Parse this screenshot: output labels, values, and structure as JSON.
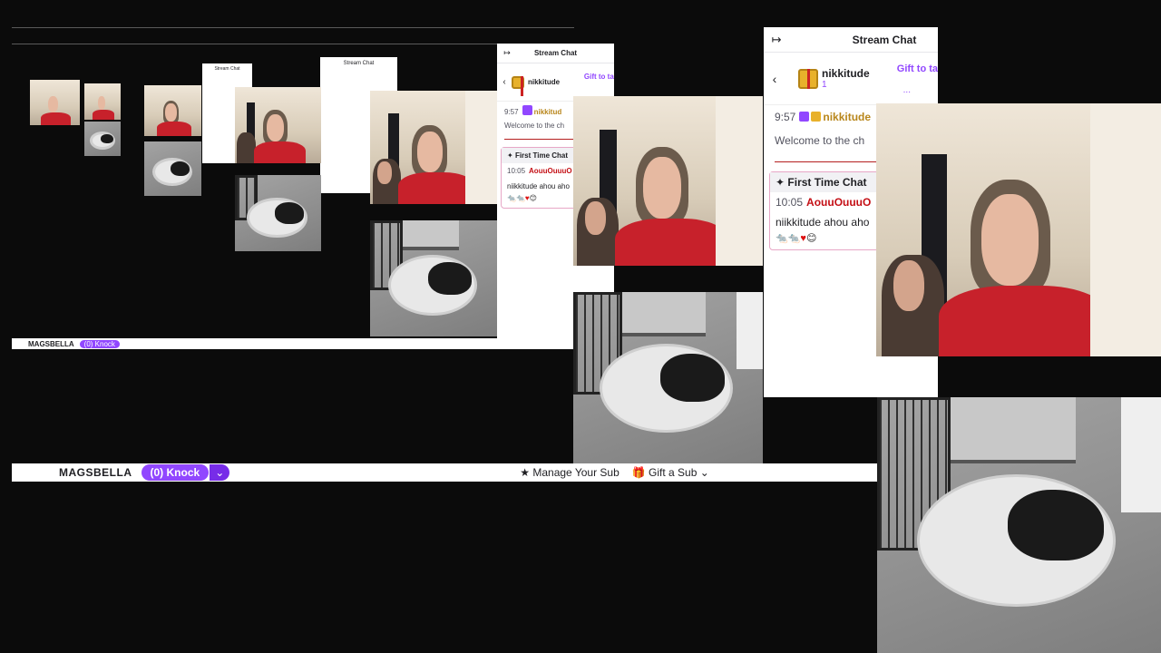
{
  "chat": {
    "title": "Stream Chat",
    "gift_user": "nikkitude",
    "gift_count": "1",
    "gift_to": "Gift to ta",
    "gift_more": "...",
    "msg1_time": "9:57",
    "msg1_user": "nikkitude",
    "welcome": "Welcome to the ch",
    "ftc_title": "First Time Chat",
    "ftc_time": "10:05",
    "ftc_user": "AouuOuuuO",
    "ftc_text": "niikkitude ahou aho"
  },
  "small_chat": {
    "title": "Stream Chat",
    "gift_user": "nikkitude",
    "gift_to": "Gift to tal",
    "msg1_time": "9:57",
    "msg1_user": "nikkitud",
    "welcome": "Welcome to the ch",
    "ftc_title": "First Time Chat",
    "ftc_time": "10:05",
    "ftc_user": "AouuOuuuO",
    "ftc_text": "niikkitude ahou aho"
  },
  "bottom_bar": {
    "channel": "MAGSBELLA",
    "knock": "(0) Knock",
    "manage": "Manage Your Sub",
    "gift": "Gift a Sub"
  },
  "colors": {
    "twitch_purple": "#9147ff",
    "first_time_user": "#c40f15",
    "gift_user": "#b8861b"
  },
  "icons": [
    "collapse-chat-icon",
    "back-chevron-icon",
    "gift-icon",
    "sparkle-icon",
    "heart-icon"
  ]
}
